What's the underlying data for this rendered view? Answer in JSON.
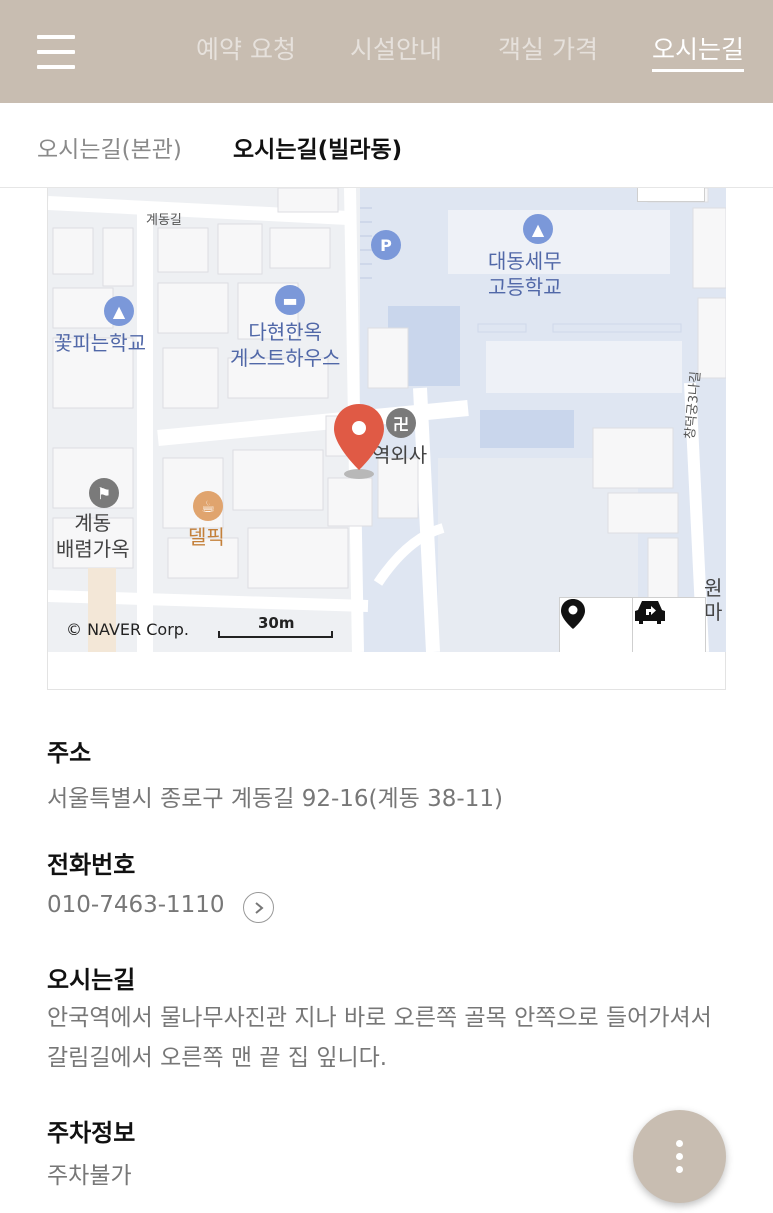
{
  "header": {
    "nav": [
      {
        "label": "예약 요청",
        "active": false
      },
      {
        "label": "시설안내",
        "active": false
      },
      {
        "label": "객실 가격",
        "active": false
      },
      {
        "label": "오시는길",
        "active": true
      }
    ],
    "background": "#c8bdb1"
  },
  "subtabs": [
    {
      "label": "오시는길(본관)",
      "active": false
    },
    {
      "label": "오시는길(빌라동)",
      "active": true
    }
  ],
  "map": {
    "labels": {
      "gyedong_gil": "계동길",
      "daedong_school": "대동세무\n고등학교",
      "kkotpi_school": "꽃피는학교",
      "dahyeon_guesthouse": "다현한옥\n게스트하우스",
      "temple": "역외사",
      "gyedong_house": "계동\n배렴가옥",
      "delpic": "델픽",
      "changdeok_road": "창덕궁3나길",
      "right_edge": "원\n마"
    },
    "copyright": "© NAVER Corp.",
    "scale": "30m",
    "icons": {
      "marker": "location-pin-icon",
      "location_button": "map-pin-icon",
      "car_button": "car-directions-icon"
    },
    "marker_color": "#e05a45"
  },
  "info": {
    "address_title": "주소",
    "address": "서울특별시 종로구 계동길 92-16(계동 38-11)",
    "phone_title": "전화번호",
    "phone": "010-7463-1110",
    "directions_title": "오시는길",
    "directions": "안국역에서 물나무사진관 지나 바로 오른쪽 골목 안쪽으로 들어가셔서 갈림길에서 오른쪽 맨 끝 집 잎니다.",
    "parking_title": "주차정보",
    "parking": "주차불가"
  }
}
